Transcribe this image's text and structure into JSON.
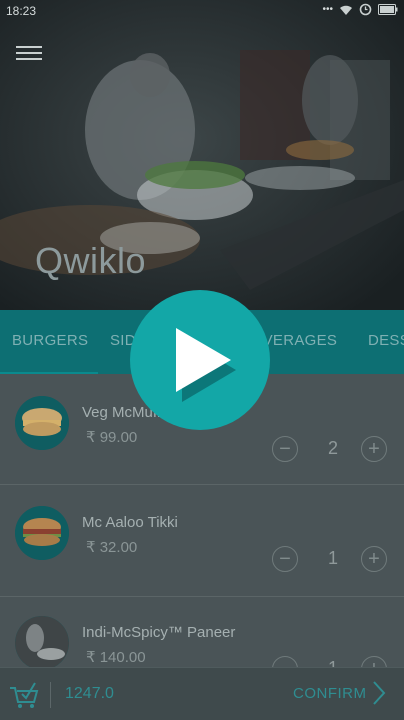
{
  "status_bar": {
    "time": "18:23",
    "dots": "•••",
    "icons": [
      "wifi-icon",
      "alarm-icon",
      "battery-icon"
    ]
  },
  "header": {
    "app_title": "Qwiklo",
    "menu_icon": "hamburger-menu-icon"
  },
  "tabs": [
    {
      "label": "BURGERS",
      "selected": true
    },
    {
      "label": "SIDES",
      "selected": false
    },
    {
      "label": "BEVERAGES",
      "selected": false
    },
    {
      "label": "DESSERTS",
      "selected": false
    }
  ],
  "menu_items": [
    {
      "name": "Veg McMuffin",
      "price": "₹ 99.00",
      "quantity": "2",
      "image": "burger-image"
    },
    {
      "name": "Mc Aaloo Tikki",
      "price": "₹ 32.00",
      "quantity": "1",
      "image": "burger-image"
    },
    {
      "name": "Indi-McSpicy™ Paneer",
      "price": "₹ 140.00",
      "quantity": "1",
      "image": "restaurant-image"
    }
  ],
  "footer": {
    "total": "1247.0",
    "confirm_label": "CONFIRM",
    "cart_icon": "cart-check-icon"
  },
  "overlay": {
    "icon": "play-icon"
  },
  "colors": {
    "accent": "#0a8a8e",
    "tab_bar": "#0d6f73",
    "overlay_dim": "#4c5659"
  }
}
